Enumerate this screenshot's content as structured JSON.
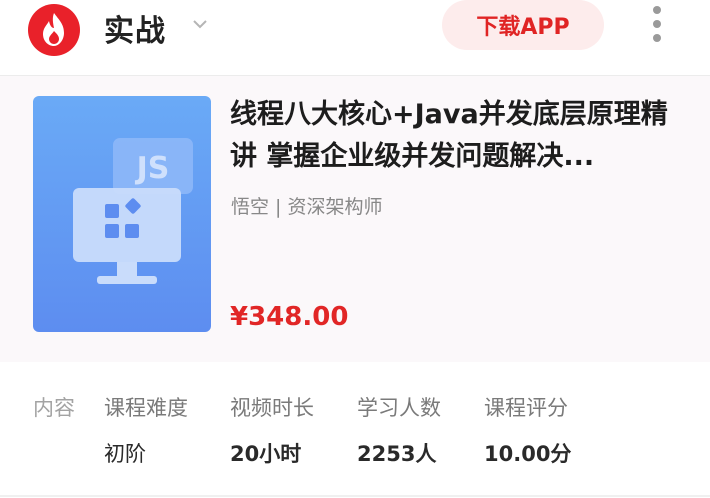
{
  "header": {
    "logo_icon": "flame-logo-icon",
    "title": "实战",
    "dropdown_icon": "chevron-down-icon",
    "download_label": "下载APP",
    "more_icon": "more-vertical-icon"
  },
  "course": {
    "cover_icons": [
      "js-badge-icon",
      "monitor-icon",
      "app-grid-icon"
    ],
    "cover_badge_text": "JS",
    "title": "线程八大核心+Java并发底层原理精讲 掌握企业级并发问题解决...",
    "author": "悟空 | 资深架构师",
    "price": "¥348.00"
  },
  "info": {
    "label": "内容",
    "stats": [
      {
        "key": "课程难度",
        "value": "初阶"
      },
      {
        "key": "视频时长",
        "value": "20小时"
      },
      {
        "key": "学习人数",
        "value": "2253人"
      },
      {
        "key": "课程评分",
        "value": "10.00分"
      }
    ]
  },
  "colors": {
    "brand_red": "#e9212a",
    "price_red": "#e12626",
    "cover_blue": "#5d8df0",
    "download_bg": "#fdecec"
  }
}
